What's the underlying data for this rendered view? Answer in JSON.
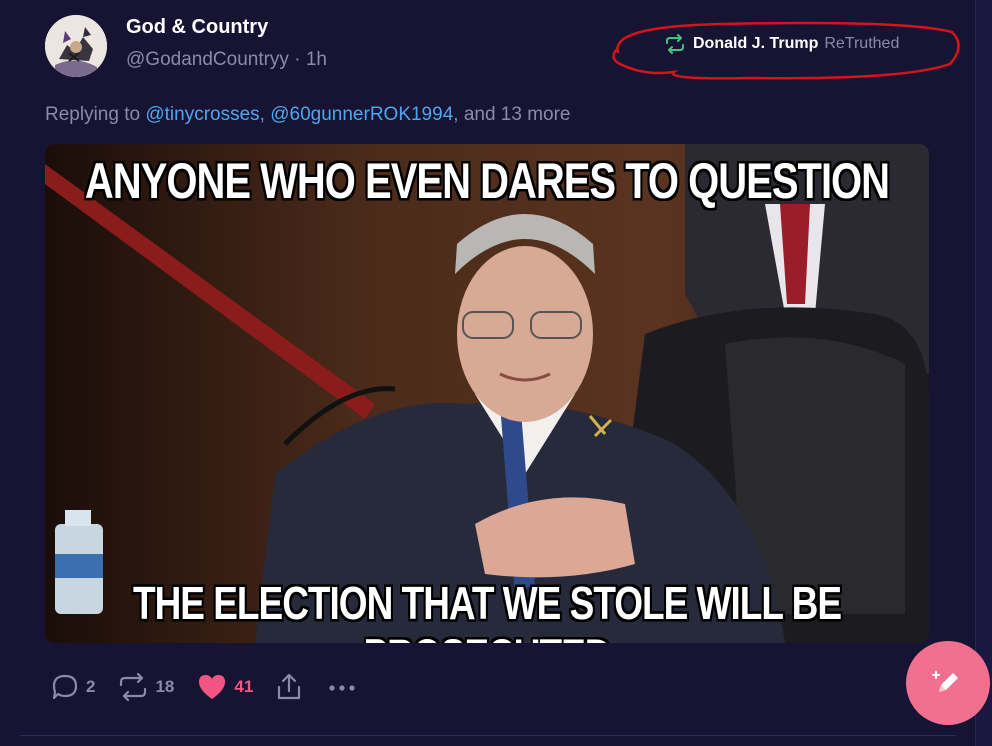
{
  "post": {
    "author_name": "God & Country",
    "author_meta": "@GodandCountryy · 1h",
    "retruth": {
      "by": "Donald J. Trump",
      "label": "ReTruthed"
    },
    "reply": {
      "prefix": "Replying to ",
      "mention_1": "@tinycrosses",
      "sep": ", ",
      "mention_2": "@60gunnerROK1994",
      "suffix": ", and 13 more"
    },
    "media": {
      "top_text": "ANYONE WHO EVEN DARES TO QUESTION",
      "bottom_text": "THE ELECTION THAT WE STOLE WILL BE PROSECUTED"
    },
    "stats": {
      "replies": "2",
      "retruths": "18",
      "likes": "41"
    }
  },
  "icons": {
    "reply": "speech-bubble-icon",
    "retruth": "retruth-arrows-icon",
    "like": "heart-icon",
    "share": "share-icon",
    "more": "more-dots-icon",
    "compose": "pencil-sparkle-icon"
  },
  "colors": {
    "background": "#161333",
    "retruth_green": "#3fc57a",
    "like_pink": "#f25582",
    "mention_blue": "#4ea6ee",
    "muted_text": "#8d89a8",
    "fab_pink": "#f2708f",
    "annotation_red": "#d4141c"
  }
}
